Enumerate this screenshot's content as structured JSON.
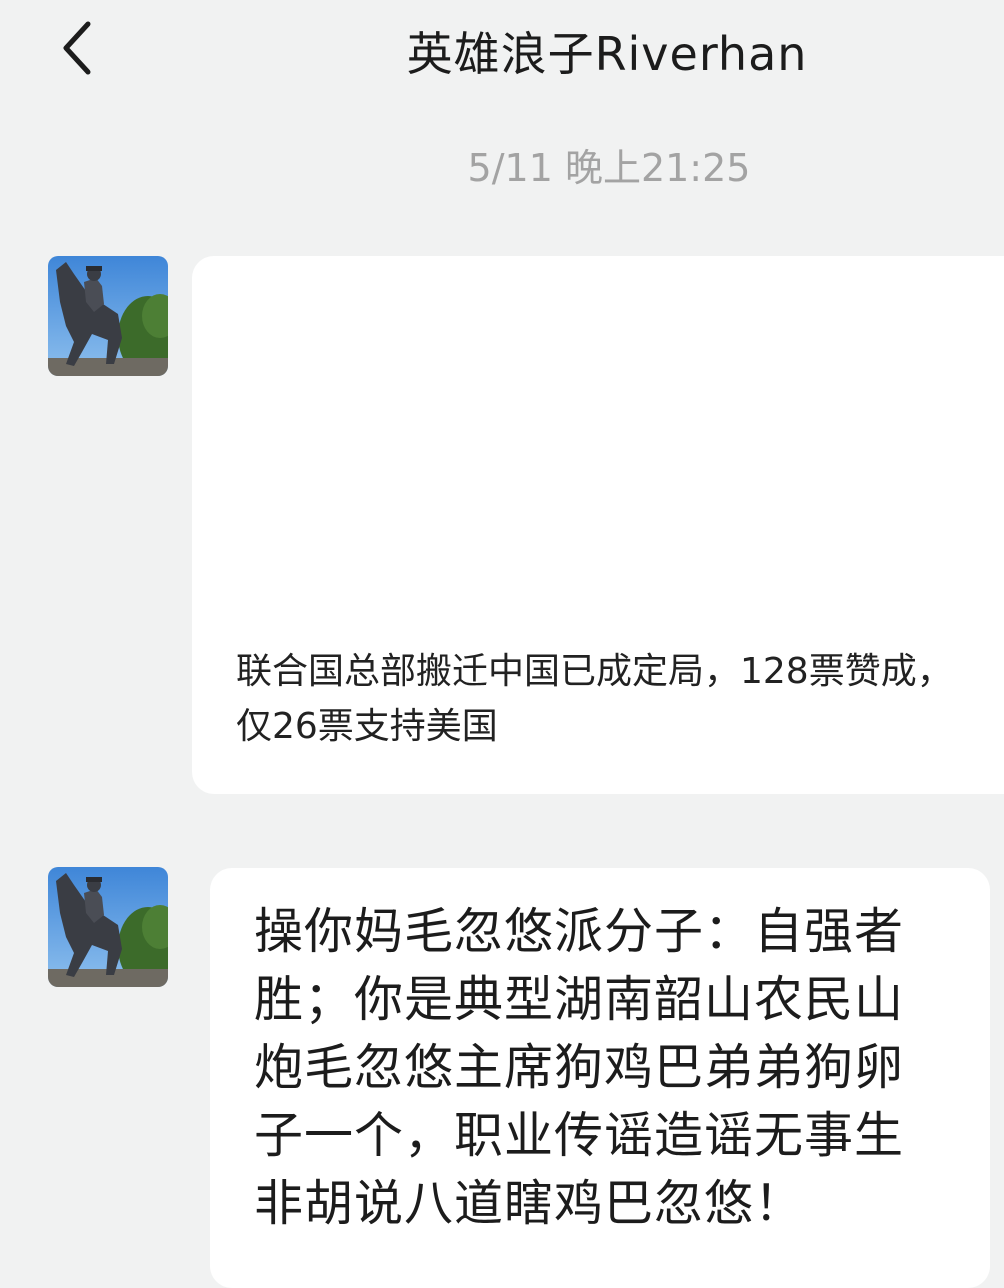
{
  "header": {
    "title": "英雄浪子Riverhan",
    "back_icon": "chevron-left-icon"
  },
  "timestamp": "5/11 晚上21:25",
  "messages": [
    {
      "sender_avatar": "avatar-statue-horseman",
      "text": "联合国总部搬迁中国已成定局，128票赞成，仅26票支持美国"
    },
    {
      "sender_avatar": "avatar-statue-horseman",
      "text": "操你妈毛忽悠派分子：自强者胜；你是典型湖南韶山农民山炮毛忽悠主席狗鸡巴弟弟狗卵子一个，职业传谣造谣无事生非胡说八道瞎鸡巴忽悠！"
    }
  ],
  "colors": {
    "background": "#f1f2f2",
    "bubble": "#ffffff",
    "timestamp": "#a3a3a3"
  }
}
